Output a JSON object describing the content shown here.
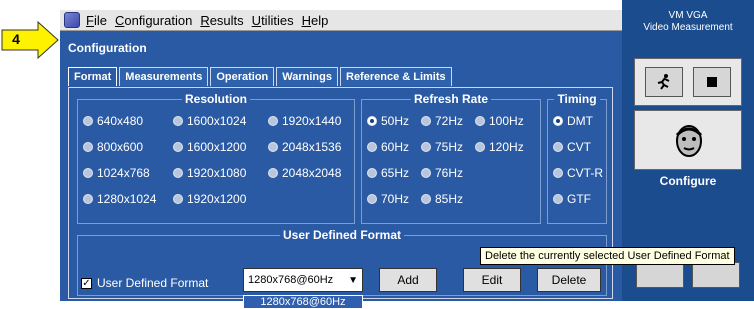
{
  "callout": {
    "label": "4"
  },
  "menu": {
    "items": [
      {
        "key": "F",
        "rest": "ile"
      },
      {
        "key": "C",
        "rest": "onfiguration"
      },
      {
        "key": "R",
        "rest": "esults"
      },
      {
        "key": "U",
        "rest": "tilities"
      },
      {
        "key": "H",
        "rest": "elp"
      }
    ]
  },
  "brand": {
    "line1": "VM VGA",
    "line2": "Video Measurement"
  },
  "panel_title": "Configuration",
  "tabs": [
    "Format",
    "Measurements",
    "Operation",
    "Warnings",
    "Reference & Limits"
  ],
  "resolution": {
    "legend": "Resolution",
    "options": [
      "640x480",
      "1600x1024",
      "1920x1440",
      "800x600",
      "1600x1200",
      "2048x1536",
      "1024x768",
      "1920x1080",
      "2048x2048",
      "1280x1024",
      "1920x1200"
    ]
  },
  "refresh": {
    "legend": "Refresh Rate",
    "options": [
      "50Hz",
      "72Hz",
      "100Hz",
      "60Hz",
      "75Hz",
      "120Hz",
      "65Hz",
      "76Hz",
      "70Hz",
      "85Hz"
    ],
    "selected": "50Hz"
  },
  "timing": {
    "legend": "Timing",
    "options": [
      "DMT",
      "CVT",
      "CVT-R",
      "GTF"
    ],
    "selected": "DMT"
  },
  "udf": {
    "legend": "User Defined Format",
    "checkbox_label": "User Defined Format",
    "checked": true,
    "select_value": "1280x768@60Hz",
    "dropdown_item": "1280x768@60Hz",
    "add": "Add",
    "edit": "Edit",
    "delete": "Delete"
  },
  "right": {
    "configure": "Configure"
  },
  "tooltip": "Delete the currently selected User Defined Format"
}
